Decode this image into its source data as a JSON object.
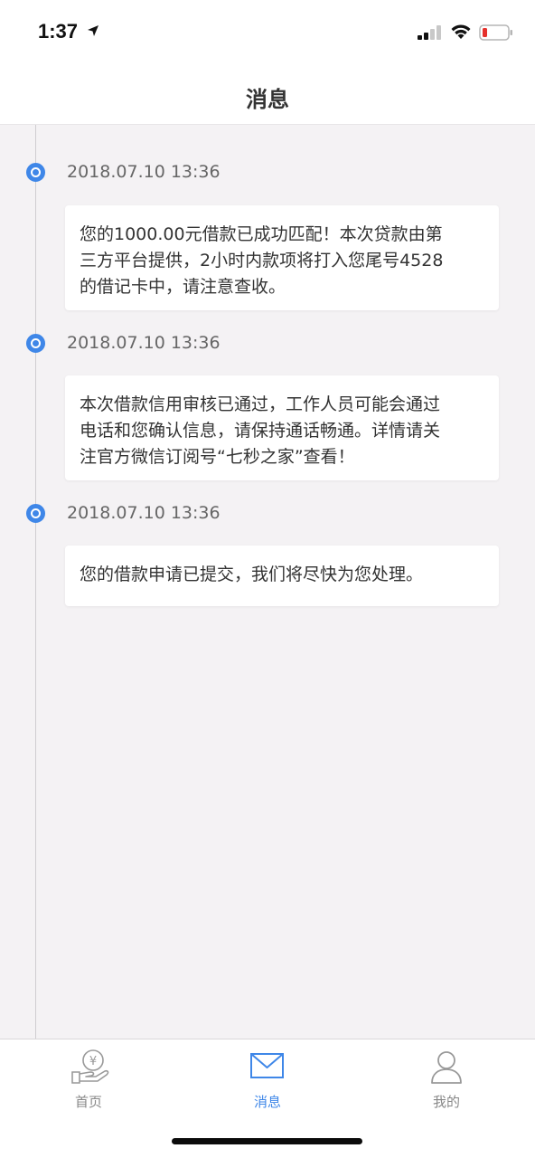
{
  "status_bar": {
    "time": "1:37"
  },
  "nav": {
    "title": "消息"
  },
  "messages": [
    {
      "timestamp": "2018.07.10 13:36",
      "lines": [
        "您的1000.00元借款已成功匹配！本次贷款由第",
        "三方平台提供，2小时内款项将打入您尾号4528",
        "的借记卡中，请注意查收。"
      ]
    },
    {
      "timestamp": "2018.07.10 13:36",
      "lines": [
        "本次借款信用审核已通过，工作人员可能会通过",
        "电话和您确认信息，请保持通话畅通。详情请关",
        "注官方微信订阅号“七秒之家”查看！"
      ]
    },
    {
      "timestamp": "2018.07.10 13:36",
      "lines": [
        "您的借款申请已提交，我们将尽快为您处理。"
      ]
    }
  ],
  "tabs": [
    {
      "label": "首页",
      "icon": "home-yen-icon",
      "active": false
    },
    {
      "label": "消息",
      "icon": "envelope-icon",
      "active": true
    },
    {
      "label": "我的",
      "icon": "user-icon",
      "active": false
    }
  ],
  "colors": {
    "accent": "#3f87e8",
    "background": "#f4f2f4",
    "battery_low": "#e5312c"
  }
}
